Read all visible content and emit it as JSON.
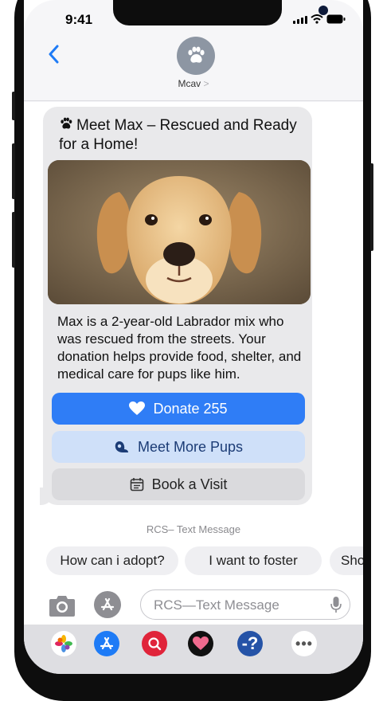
{
  "status_bar": {
    "time": "9:41"
  },
  "header": {
    "contact_name": "Mcav",
    "chevron": ">"
  },
  "message": {
    "title": "Meet Max – Rescued and Ready for a Home!",
    "body": "Max is a 2-year-old Labrador mix who was rescued from the streets. Your donation helps provide food, shelter, and medical care for pups like him.",
    "actions": [
      {
        "label": "Donate 255",
        "icon": "heart-icon"
      },
      {
        "label": "Meet More Pups",
        "icon": "pups-icon"
      },
      {
        "label": "Book a Visit",
        "icon": "calendar-icon"
      }
    ]
  },
  "system_label": "RCS– Text Message",
  "suggestions": [
    "How can i adopt?",
    "I want to foster",
    "Sho"
  ],
  "composer": {
    "placeholder": "RCS—Text Message"
  },
  "app_tray": [
    "photos-app-icon",
    "app-store-icon",
    "search-app-icon",
    "heart-app-icon",
    "help-app-icon",
    "more-apps-icon"
  ],
  "colors": {
    "accent": "#2f7df6",
    "accent_light": "#cfe0f9",
    "bubble": "#e9e9eb",
    "back": "#1e7bf6"
  }
}
